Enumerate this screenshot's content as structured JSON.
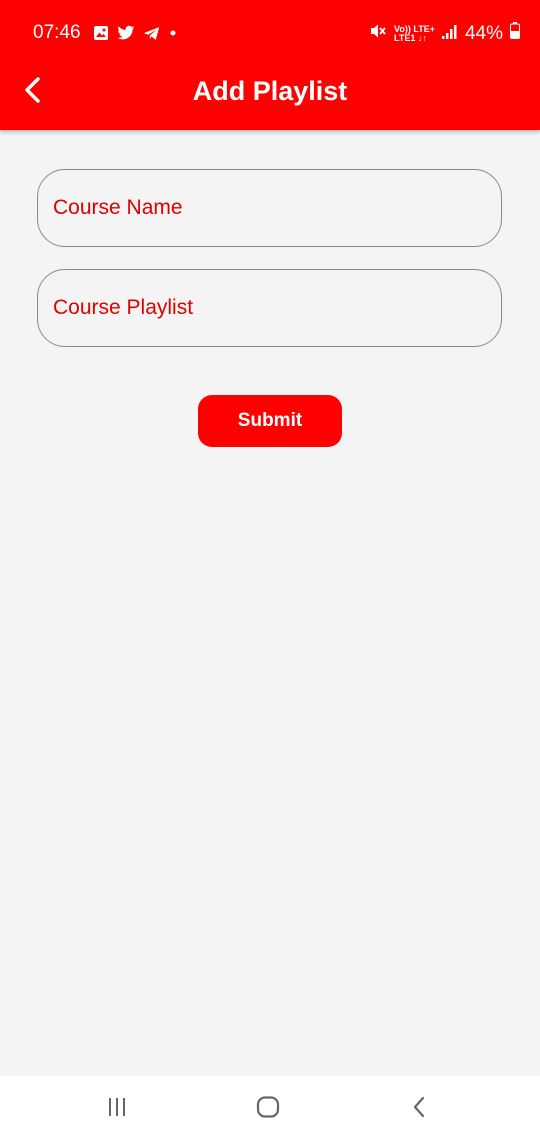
{
  "status_bar": {
    "time": "07:46",
    "network_top": "Vo)) LTE+",
    "network_bottom": "LTE1 ↓↑",
    "battery": "44%"
  },
  "app_bar": {
    "title": "Add Playlist",
    "back_icon": "chevron-left-icon"
  },
  "form": {
    "course_name_placeholder": "Course Name",
    "course_name_value": "",
    "course_playlist_placeholder": "Course Playlist",
    "course_playlist_value": "",
    "submit_label": "Submit"
  },
  "nav_bar": {
    "icons": [
      "recent-apps-icon",
      "home-icon",
      "back-icon"
    ]
  },
  "colors": {
    "accent": "#ff0000",
    "background": "#f4f4f4",
    "field_text": "#e00000",
    "field_border": "#8a8a8a"
  }
}
